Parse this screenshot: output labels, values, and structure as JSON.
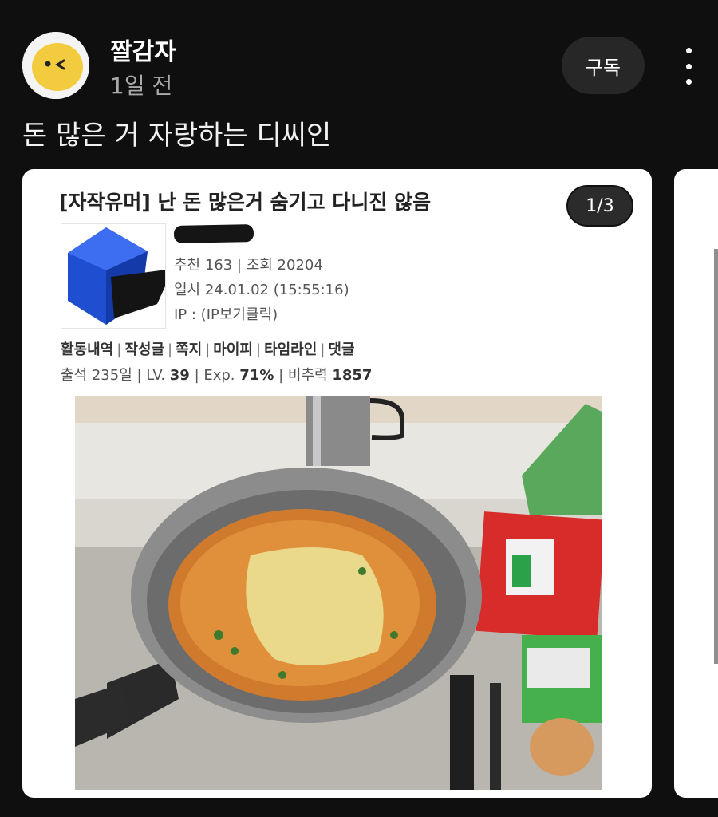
{
  "channel": {
    "name": "짤감자",
    "time": "1일 전",
    "subscribe_label": "구독",
    "more_icon": "more-vertical-icon",
    "avatar_icon": "potato-face-icon"
  },
  "post": {
    "text": "돈 많은 거 자랑하는 디씨인"
  },
  "card": {
    "page_counter": "1/3",
    "title": "[자작유머] 난 돈 많은거 숨기고 다니진 않음",
    "meta_recommend": "추천 163 | 조회 20204",
    "meta_date": "일시 24.01.02 (15:55:16)",
    "meta_ip": "IP : (IP보기클릭)",
    "links": [
      "활동내역",
      "작성글",
      "쪽지",
      "마이피",
      "타임라인",
      "댓글"
    ],
    "stats": {
      "attend": "출석 235일",
      "lv_label": "LV.",
      "lv_value": "39",
      "exp_label": "Exp.",
      "exp_value": "71%",
      "ratio_label": "비추력",
      "ratio_value": "1857"
    },
    "profile_icon": "blue-cube-icon",
    "photo_subject": "ramen-pot-photo"
  },
  "colors": {
    "background": "#0f0f0f",
    "subscribe_bg": "#272727",
    "card_bg": "#ffffff",
    "avatar_yellow": "#f2cc3e",
    "cube_blue": "#1f4fd0"
  }
}
